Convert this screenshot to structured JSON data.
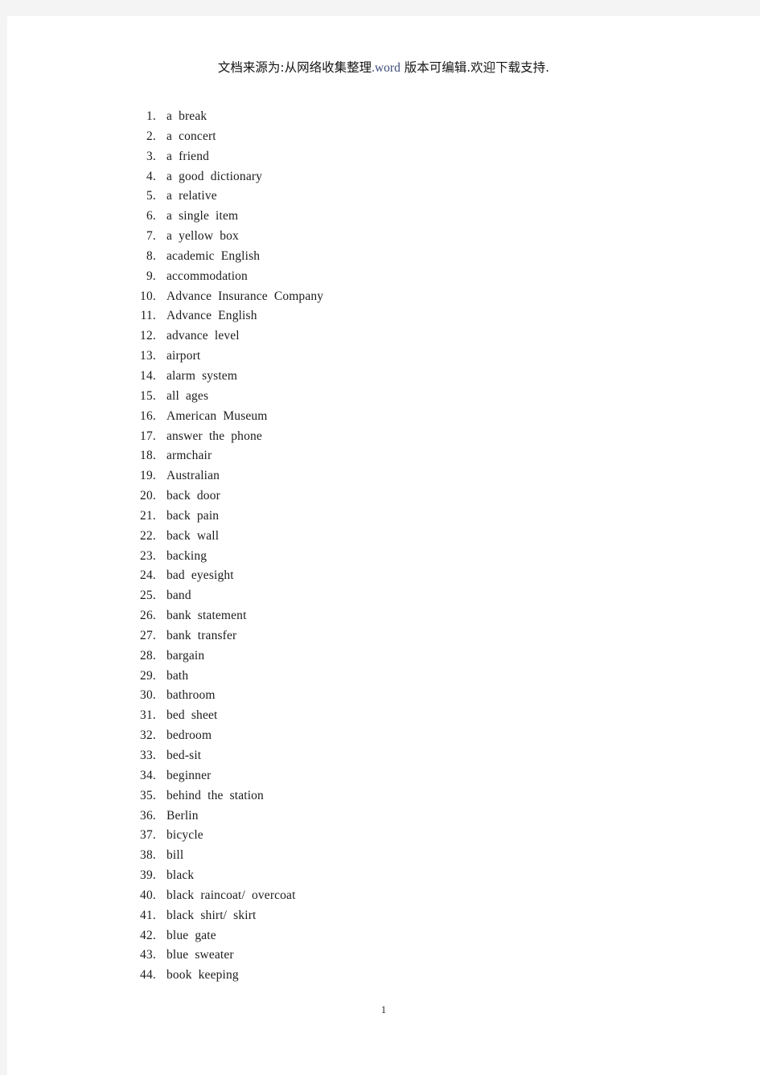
{
  "document": {
    "header_banner": {
      "full_text": "文档来源为:从网络收集整理.word 版本可编辑.欢迎下载支持.",
      "segment_source": "文档来源为:从网络收集整理",
      "segment_word": ".word",
      "segment_editable": " 版本可编辑.欢迎下载支持.",
      "color_chinese": "#141414",
      "color_word": "#3b4a7a"
    },
    "footer": {
      "page_number": "1"
    },
    "list": {
      "items": [
        {
          "num": "1.",
          "text": "a  break"
        },
        {
          "num": "2.",
          "text": "a  concert"
        },
        {
          "num": "3.",
          "text": "a  friend"
        },
        {
          "num": "4.",
          "text": "a  good  dictionary"
        },
        {
          "num": "5.",
          "text": "a  relative"
        },
        {
          "num": "6.",
          "text": "a  single  item"
        },
        {
          "num": "7.",
          "text": "a  yellow  box"
        },
        {
          "num": "8.",
          "text": "academic  English"
        },
        {
          "num": "9.",
          "text": "accommodation"
        },
        {
          "num": "10.",
          "text": "Advance  Insurance  Company"
        },
        {
          "num": "11.",
          "text": "Advance  English"
        },
        {
          "num": "12.",
          "text": "advance  level"
        },
        {
          "num": "13.",
          "text": "airport"
        },
        {
          "num": "14.",
          "text": "alarm  system"
        },
        {
          "num": "15.",
          "text": "all  ages"
        },
        {
          "num": "16.",
          "text": "American  Museum"
        },
        {
          "num": "17.",
          "text": "answer  the  phone"
        },
        {
          "num": "18.",
          "text": "armchair"
        },
        {
          "num": "19.",
          "text": "Australian"
        },
        {
          "num": "20.",
          "text": "back  door"
        },
        {
          "num": "21.",
          "text": "back  pain"
        },
        {
          "num": "22.",
          "text": "back  wall"
        },
        {
          "num": "23.",
          "text": "backing"
        },
        {
          "num": "24.",
          "text": "bad  eyesight"
        },
        {
          "num": "25.",
          "text": "band"
        },
        {
          "num": "26.",
          "text": "bank  statement"
        },
        {
          "num": "27.",
          "text": "bank  transfer"
        },
        {
          "num": "28.",
          "text": "bargain"
        },
        {
          "num": "29.",
          "text": "bath"
        },
        {
          "num": "30.",
          "text": "bathroom"
        },
        {
          "num": "31.",
          "text": "bed  sheet"
        },
        {
          "num": "32.",
          "text": "bedroom"
        },
        {
          "num": "33.",
          "text": "bed-sit"
        },
        {
          "num": "34.",
          "text": "beginner"
        },
        {
          "num": "35.",
          "text": "behind  the  station"
        },
        {
          "num": "36.",
          "text": "Berlin"
        },
        {
          "num": "37.",
          "text": "bicycle"
        },
        {
          "num": "38.",
          "text": "bill"
        },
        {
          "num": "39.",
          "text": "black"
        },
        {
          "num": "40.",
          "text": "black  raincoat/  overcoat"
        },
        {
          "num": "41.",
          "text": "black  shirt/  skirt"
        },
        {
          "num": "42.",
          "text": "blue  gate"
        },
        {
          "num": "43.",
          "text": "blue  sweater"
        },
        {
          "num": "44.",
          "text": "book  keeping"
        }
      ]
    }
  }
}
